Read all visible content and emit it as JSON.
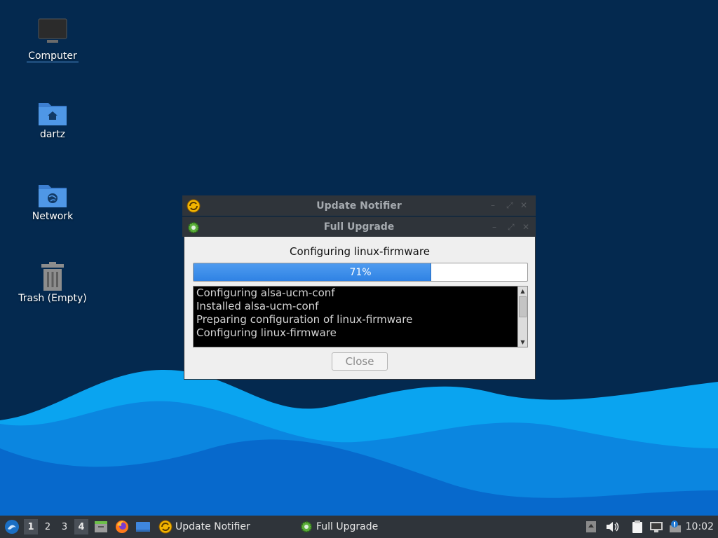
{
  "desktop": {
    "icons": [
      {
        "label": "Computer"
      },
      {
        "label": "dartz"
      },
      {
        "label": "Network"
      },
      {
        "label": "Trash (Empty)"
      }
    ]
  },
  "windows": {
    "notifier": {
      "title": "Update Notifier"
    },
    "upgrade": {
      "title": "Full Upgrade",
      "status": "Configuring linux-firmware",
      "progress_text": "71%",
      "progress_value": 0.71,
      "log": "Configuring alsa-ucm-conf\nInstalled alsa-ucm-conf\nPreparing configuration of linux-firmware\nConfiguring linux-firmware",
      "close_label": "Close"
    }
  },
  "taskbar": {
    "workspaces": [
      "1",
      "2",
      "3",
      "4"
    ],
    "tasks": [
      {
        "label": "Update Notifier"
      },
      {
        "label": "Full Upgrade"
      }
    ],
    "clock": "10:02"
  },
  "colors": {
    "desktop_bg": "#04294f",
    "wave_light": "#1aa0ee",
    "wave_dark": "#0a6fd0",
    "progress": "#3a8ee9",
    "panel": "#2f343a"
  }
}
